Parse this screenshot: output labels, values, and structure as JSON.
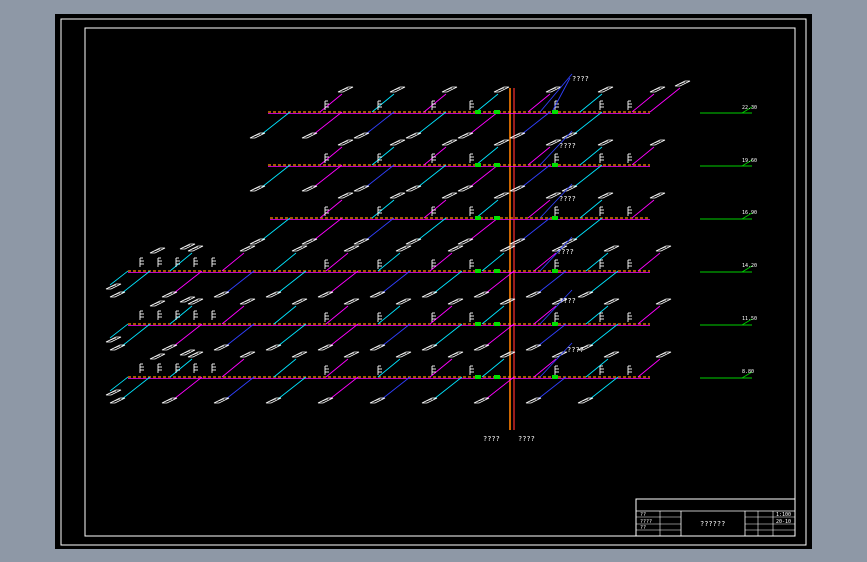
{
  "colors": {
    "background": "#8e98a6",
    "sheet": "#000000",
    "frame": "#ffffff",
    "riser_left": "#ff7f00",
    "riser_right": "#ff3030",
    "pipe_dash": "#ff8c00",
    "pipe_magenta": "#ff00ff",
    "pipe_cyan": "#00e5ff",
    "pipe_blue": "#3040ff",
    "fixture": "#ffffff",
    "valve": "#00e000",
    "level_line": "#00d000"
  },
  "diagram": {
    "branch_annotations": [
      "????",
      "????",
      "????",
      "????",
      "????",
      "????"
    ],
    "riser_bottom_labels": [
      "????",
      "????"
    ],
    "level_marks": [
      "22.30",
      "19.60",
      "16.90",
      "14.20",
      "11.50",
      "8.80"
    ]
  },
  "title_block": {
    "drawing_title": "??????",
    "row_labels": [
      "??",
      "????",
      "??"
    ],
    "scale": "1:100",
    "sheet_no": "20-10"
  }
}
